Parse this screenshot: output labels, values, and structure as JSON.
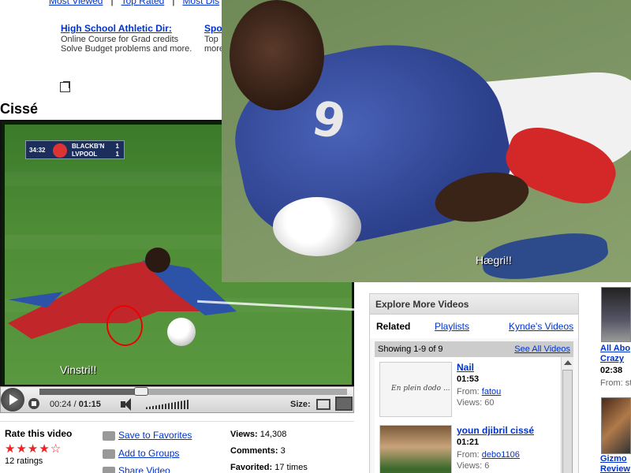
{
  "topnav": {
    "items": [
      "Most Viewed",
      "Top Rated",
      "Most Dis"
    ]
  },
  "ads": [
    {
      "title": "High School Athletic Dir:",
      "body": "Online Course for Grad credits Solve Budget problems and more."
    },
    {
      "title": "Spo",
      "body": "Top more"
    }
  ],
  "video": {
    "title": "Cissé",
    "scorebug": {
      "clock": "34:32",
      "team1": "BLACKB'N",
      "team2": "LVPOOL",
      "score1": "1",
      "score2": "1"
    },
    "caption": "Vinstri!!",
    "time_current": "00:24",
    "time_total": "01:15",
    "progress_fraction": 0.33,
    "size_label": "Size:"
  },
  "actions": {
    "rate_title": "Rate this video",
    "stars_filled": 4,
    "stars_total": 5,
    "ratings": "12 ratings",
    "save": "Save to Favorites",
    "groups": "Add to Groups",
    "share": "Share Video",
    "views_label": "Views:",
    "views": "14,308",
    "comments_label": "Comments:",
    "comments": "3",
    "favorited_label": "Favorited:",
    "favorited": "17 times"
  },
  "photo": {
    "jersey_number": "9",
    "caption": "Hægri!!"
  },
  "explore": {
    "heading": "Explore More Videos",
    "tabs": [
      "Related",
      "Playlists",
      "Kynde's Videos"
    ],
    "count": "Showing 1-9 of 9",
    "see_all": "See All Videos",
    "videos": [
      {
        "title": "Nail",
        "duration": "01:53",
        "from_label": "From:",
        "from": "fatou",
        "views_label": "Views:",
        "views": "60",
        "thumb_text": "En plein dodo ..."
      },
      {
        "title": "youn djibril cissé",
        "duration": "01:21",
        "from_label": "From:",
        "from": "debo1106",
        "views_label": "Views:",
        "views": "6",
        "thumb_text": ""
      }
    ]
  },
  "right_column": [
    {
      "title_line1": "All Abo",
      "title_line2": "Crazy",
      "duration": "02:38",
      "from": "From: st"
    },
    {
      "title_line1": "Gizmo",
      "title_line2": "Review"
    }
  ],
  "colors": {
    "link": "#0033cc",
    "star": "#ee2222",
    "annotation": "#ee0000"
  }
}
